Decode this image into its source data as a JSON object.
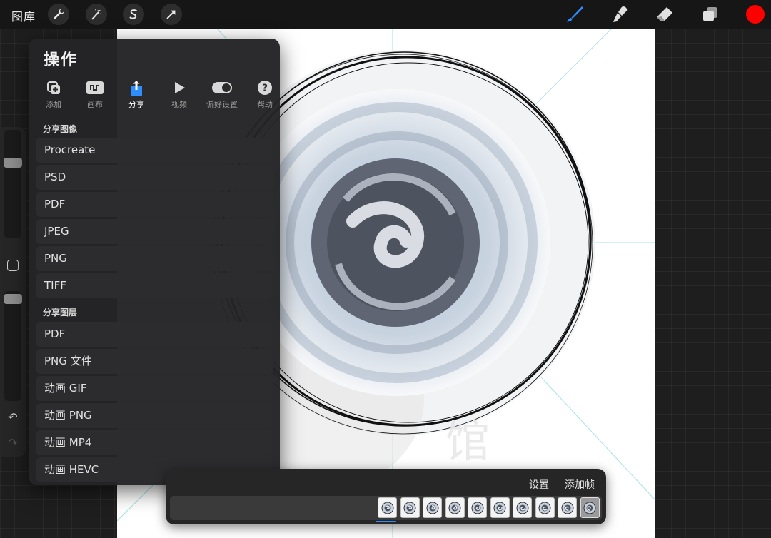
{
  "topbar": {
    "gallery_label": "图库",
    "left_tools": [
      "wrench-icon",
      "magic-wand-icon",
      "selection-s-icon",
      "transform-arrow-icon"
    ],
    "right_tools": [
      "brush-icon",
      "smudge-icon",
      "eraser-icon",
      "layers-icon"
    ],
    "active_tool": "brush-icon",
    "active_tool_color": "#2e8dff",
    "current_color": "#ff0000"
  },
  "panel": {
    "title": "操作",
    "tabs": [
      {
        "label": "添加",
        "icon": "add-icon"
      },
      {
        "label": "画布",
        "icon": "canvas-icon"
      },
      {
        "label": "分享",
        "icon": "share-icon"
      },
      {
        "label": "视频",
        "icon": "video-play-icon"
      },
      {
        "label": "偏好设置",
        "icon": "toggle-icon"
      },
      {
        "label": "帮助",
        "icon": "help-icon"
      }
    ],
    "active_tab": "分享",
    "share_image_heading": "分享图像",
    "share_image_items": [
      "Procreate",
      "PSD",
      "PDF",
      "JPEG",
      "PNG",
      "TIFF"
    ],
    "share_layers_heading": "分享图层",
    "share_layers_items": [
      "PDF",
      "PNG 文件",
      "动画 GIF",
      "动画 PNG",
      "动画 MP4",
      "动画 HEVC"
    ]
  },
  "sidebar": {
    "brush_size_level": 0.72,
    "opacity_level": 0.97
  },
  "animation": {
    "settings_label": "设置",
    "add_frame_label": "添加帧",
    "frame_count": 10,
    "selected_frame": 10
  }
}
